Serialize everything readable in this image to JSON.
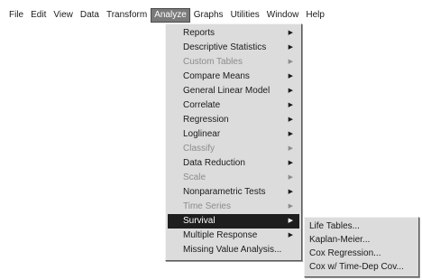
{
  "menubar": {
    "items": [
      {
        "label": "File"
      },
      {
        "label": "Edit"
      },
      {
        "label": "View"
      },
      {
        "label": "Data"
      },
      {
        "label": "Transform"
      },
      {
        "label": "Analyze"
      },
      {
        "label": "Graphs"
      },
      {
        "label": "Utilities"
      },
      {
        "label": "Window"
      },
      {
        "label": "Help"
      }
    ],
    "active": "Analyze"
  },
  "analyze_menu": {
    "items": [
      {
        "label": "Reports",
        "has_submenu": true,
        "enabled": true
      },
      {
        "label": "Descriptive Statistics",
        "has_submenu": true,
        "enabled": true
      },
      {
        "label": "Custom Tables",
        "has_submenu": true,
        "enabled": false
      },
      {
        "label": "Compare Means",
        "has_submenu": true,
        "enabled": true
      },
      {
        "label": "General Linear Model",
        "has_submenu": true,
        "enabled": true
      },
      {
        "label": "Correlate",
        "has_submenu": true,
        "enabled": true
      },
      {
        "label": "Regression",
        "has_submenu": true,
        "enabled": true
      },
      {
        "label": "Loglinear",
        "has_submenu": true,
        "enabled": true
      },
      {
        "label": "Classify",
        "has_submenu": true,
        "enabled": false
      },
      {
        "label": "Data Reduction",
        "has_submenu": true,
        "enabled": true
      },
      {
        "label": "Scale",
        "has_submenu": true,
        "enabled": false
      },
      {
        "label": "Nonparametric Tests",
        "has_submenu": true,
        "enabled": true
      },
      {
        "label": "Time Series",
        "has_submenu": true,
        "enabled": false
      },
      {
        "label": "Survival",
        "has_submenu": true,
        "enabled": true,
        "selected": true
      },
      {
        "label": "Multiple Response",
        "has_submenu": true,
        "enabled": true
      },
      {
        "label": "Missing Value Analysis...",
        "has_submenu": false,
        "enabled": true
      }
    ]
  },
  "survival_submenu": {
    "items": [
      {
        "label": "Life Tables..."
      },
      {
        "label": "Kaplan-Meier..."
      },
      {
        "label": "Cox Regression..."
      },
      {
        "label": "Cox w/ Time-Dep Cov..."
      }
    ]
  },
  "icons": {
    "submenu_arrow": "submenu-arrow-icon"
  },
  "colors": {
    "menu_bg": "#dcdcdc",
    "selected_bg": "#1e1e1e",
    "active_menubar_bg": "#7a7a7a",
    "disabled_text": "#8c8c8c"
  }
}
